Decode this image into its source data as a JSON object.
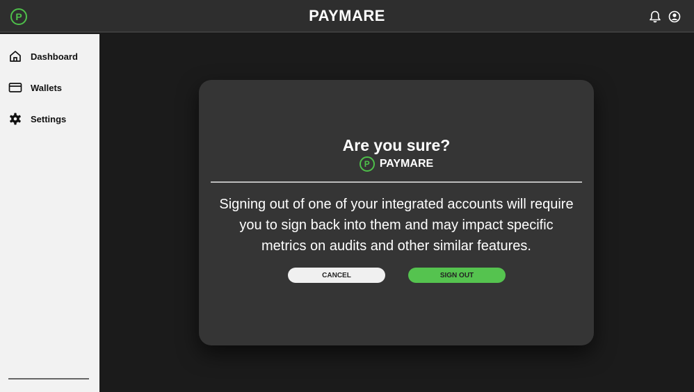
{
  "colors": {
    "accent": "#4ec04a",
    "topbar": "#2e2e2e",
    "sidebar": "#f2f2f2",
    "modal": "#353535",
    "background": "#1b1b1b"
  },
  "header": {
    "logo_letter": "P",
    "title": "PAYMARE",
    "icons": [
      "bell-icon",
      "user-icon"
    ]
  },
  "sidebar": {
    "items": [
      {
        "label": "Dashboard",
        "icon": "home-icon"
      },
      {
        "label": "Wallets",
        "icon": "card-icon"
      },
      {
        "label": "Settings",
        "icon": "gear-icon"
      }
    ]
  },
  "modal": {
    "title": "Are you sure?",
    "brand_letter": "P",
    "brand_name": "PAYMARE",
    "message": "Signing out of one of your integrated accounts will require you to sign back into them and may impact specific metrics on audits and other similar features.",
    "cancel_label": "CANCEL",
    "signout_label": "SIGN OUT"
  }
}
